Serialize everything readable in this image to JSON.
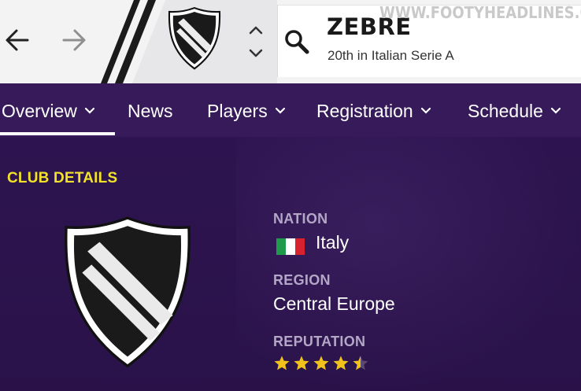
{
  "watermark": "WWW.FOOTYHEADLINES.COM",
  "header": {
    "club_name": "ZEBRE",
    "club_subtitle": "20th in Italian Serie A",
    "icons": {
      "back": "arrow-left-icon",
      "forward": "arrow-right-icon",
      "up": "chevron-up-icon",
      "down": "chevron-down-icon",
      "search": "search-icon",
      "crest": "club-crest-icon"
    }
  },
  "tabs": [
    {
      "label": "Overview",
      "has_dropdown": true,
      "active": true
    },
    {
      "label": "News",
      "has_dropdown": false,
      "active": false
    },
    {
      "label": "Players",
      "has_dropdown": true,
      "active": false
    },
    {
      "label": "Registration",
      "has_dropdown": true,
      "active": false
    },
    {
      "label": "Schedule",
      "has_dropdown": true,
      "active": false
    }
  ],
  "club_details": {
    "section_title": "CLUB DETAILS",
    "nation_label": "NATION",
    "nation_value": "Italy",
    "nation_flag_colors": [
      "#1e9a4a",
      "#ffffff",
      "#d8232f"
    ],
    "region_label": "REGION",
    "region_value": "Central Europe",
    "reputation_label": "REPUTATION",
    "reputation_stars": 4.5,
    "reputation_max": 5
  },
  "colors": {
    "accent_yellow": "#f2e22a",
    "tab_bar": "#361a5a",
    "panel": "#2a1249",
    "label": "#b3a6c7",
    "star": "#f2c21a"
  }
}
